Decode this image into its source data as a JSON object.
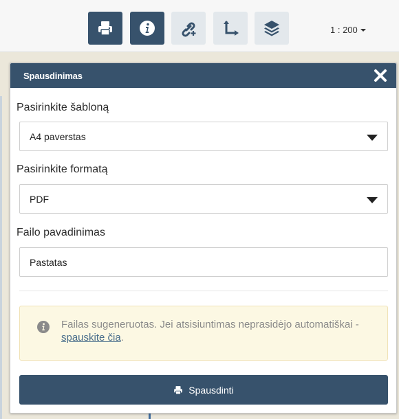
{
  "toolbar": {
    "buttons": [
      {
        "icon": "print-icon",
        "active": true
      },
      {
        "icon": "info-icon",
        "active": true
      },
      {
        "icon": "link-add-icon",
        "active": false
      },
      {
        "icon": "measure-axes-icon",
        "active": false
      },
      {
        "icon": "layers-icon",
        "active": false
      }
    ],
    "scale": "1 : 200"
  },
  "panel": {
    "title": "Spausdinimas",
    "template_label": "Pasirinkite šabloną",
    "template_value": "A4 paverstas",
    "format_label": "Pasirinkite formatą",
    "format_value": "PDF",
    "filename_label": "Failo pavadinimas",
    "filename_value": "Pastatas",
    "alert_text": "Failas sugeneruotas. Jei atsisiuntimas neprasidėjo automatiškai - ",
    "alert_link": "spauskite čia",
    "alert_suffix": ".",
    "print_button": "Spausdinti"
  },
  "colors": {
    "primary": "#37526c",
    "toolbar_inactive": "#e3e8ec",
    "alert_bg": "#fcf8e3",
    "alert_border": "#f0e2b6"
  }
}
